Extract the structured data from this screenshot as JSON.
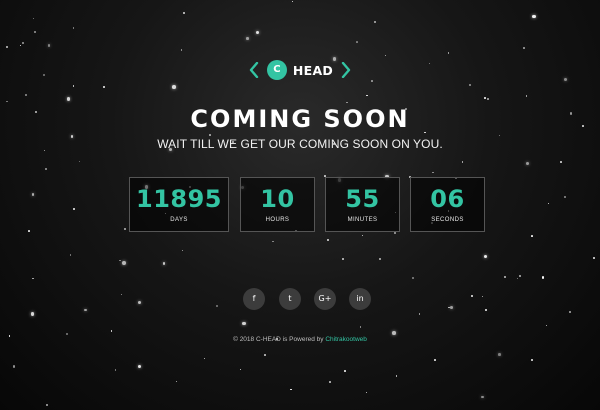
{
  "brand": {
    "badge_letter": "C",
    "name": "HEAD",
    "accent_color": "#33c4a3"
  },
  "hero": {
    "title": "COMING SOON",
    "subtitle": "WAIT TILL WE GET OUR COMING SOON ON YOU."
  },
  "countdown": [
    {
      "value": "11895",
      "label": "DAYS"
    },
    {
      "value": "10",
      "label": "HOURS"
    },
    {
      "value": "55",
      "label": "MINUTES"
    },
    {
      "value": "06",
      "label": "SECONDS"
    }
  ],
  "social": [
    {
      "label": "f",
      "icon": "facebook-icon"
    },
    {
      "label": "t",
      "icon": "twitter-icon"
    },
    {
      "label": "G+",
      "icon": "google-plus-icon"
    },
    {
      "label": "in",
      "icon": "linkedin-icon"
    }
  ],
  "footer": {
    "text": "© 2018 C-HEAD is Powered by",
    "link": "Chitrakootweb"
  }
}
